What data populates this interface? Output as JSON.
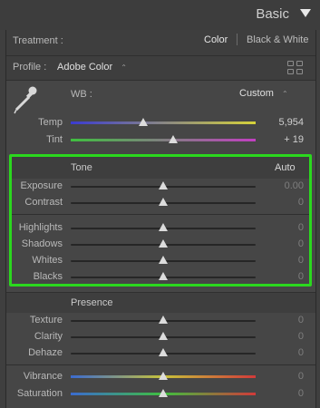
{
  "header": {
    "title": "Basic"
  },
  "treatment": {
    "label": "Treatment :",
    "options": [
      "Color",
      "Black & White"
    ],
    "selected": "Color"
  },
  "profile": {
    "label": "Profile :",
    "value": "Adobe Color",
    "chevron": "⌃"
  },
  "wb": {
    "label": "WB :",
    "value": "Custom",
    "chevron": "⌃"
  },
  "temp": {
    "label": "Temp",
    "value": "5,954",
    "position": 0.4
  },
  "tint": {
    "label": "Tint",
    "value": "+ 19",
    "position": 0.55
  },
  "tone": {
    "title": "Tone",
    "auto_label": "Auto",
    "sliders": [
      {
        "label": "Exposure",
        "value": "0.00",
        "position": 0.5
      },
      {
        "label": "Contrast",
        "value": "0",
        "position": 0.5
      },
      {
        "label": "Highlights",
        "value": "0",
        "position": 0.5
      },
      {
        "label": "Shadows",
        "value": "0",
        "position": 0.5
      },
      {
        "label": "Whites",
        "value": "0",
        "position": 0.5
      },
      {
        "label": "Blacks",
        "value": "0",
        "position": 0.5
      }
    ]
  },
  "presence": {
    "title": "Presence",
    "sliders": [
      {
        "label": "Texture",
        "value": "0",
        "position": 0.5
      },
      {
        "label": "Clarity",
        "value": "0",
        "position": 0.5
      },
      {
        "label": "Dehaze",
        "value": "0",
        "position": 0.5
      },
      {
        "label": "Vibrance",
        "value": "0",
        "position": 0.5
      },
      {
        "label": "Saturation",
        "value": "0",
        "position": 0.5
      }
    ]
  },
  "colors": {
    "highlight_box": "#2bd81e",
    "temp_gradient": [
      "#3b3bd0",
      "#d6d23a"
    ],
    "tint_gradient": [
      "#3fbf3f",
      "#c23fc2"
    ],
    "vibrance_gradient": [
      "#3b6bd0",
      "#c7c23a",
      "#d23a3a"
    ],
    "saturation_gradient": [
      "#3b6bd0",
      "#3fbf3f",
      "#d23a3a"
    ]
  }
}
